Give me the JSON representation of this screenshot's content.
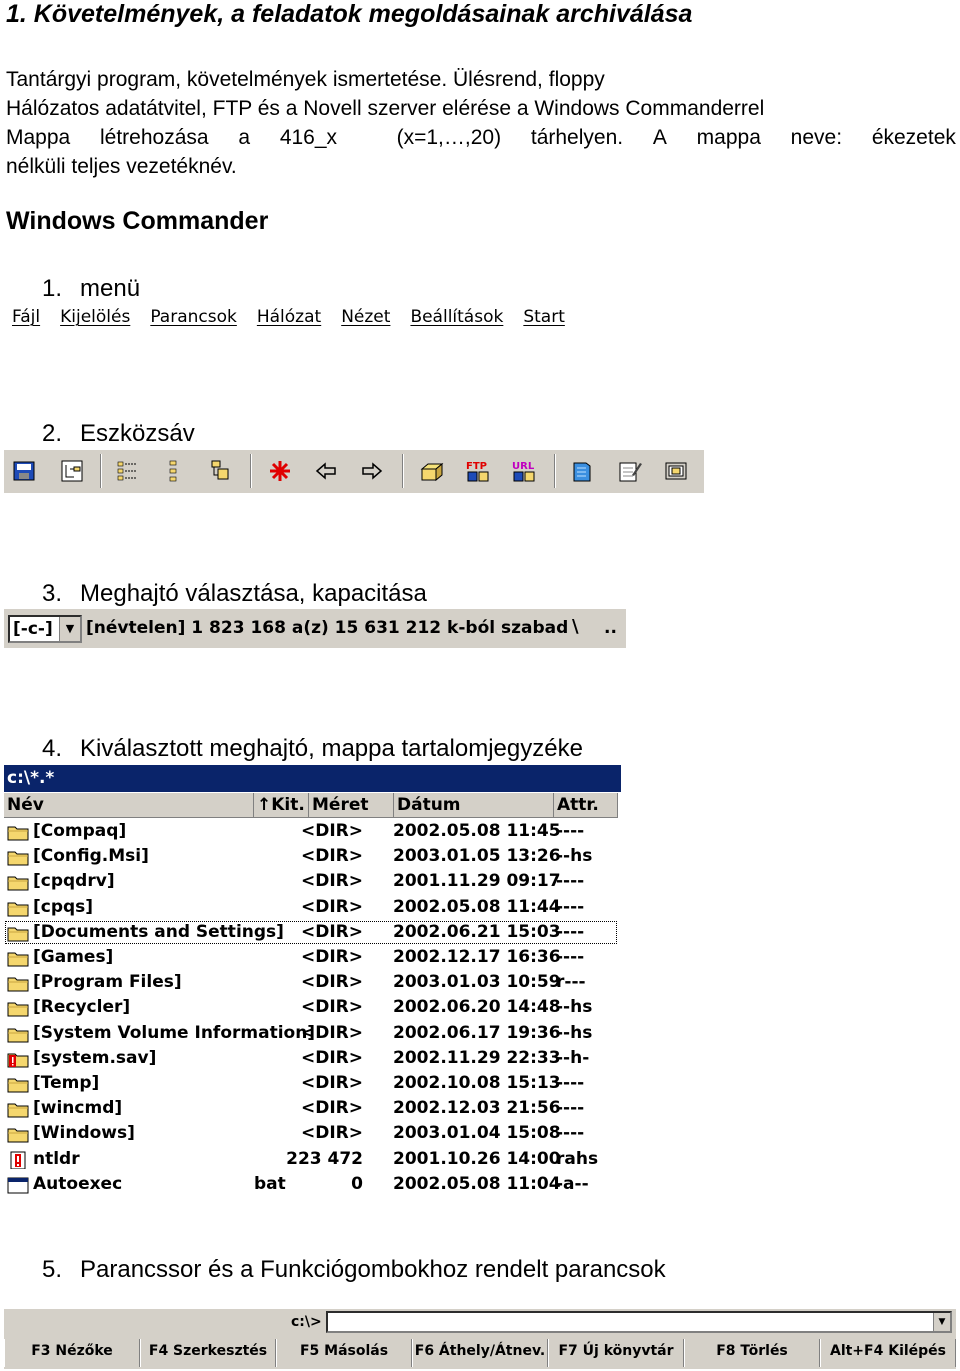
{
  "heading": "1. Követelmények, a feladatok megoldásainak archiválása",
  "intro": {
    "line1": "Tantárgyi program, követelmények ismertetése. Ülésrend, floppy",
    "line2": "Hálózatos adatátvitel, FTP és a Novell szerver elérése a Windows Commanderrel",
    "line3_words": [
      "Mappa",
      "létrehozása",
      "a",
      "416_x",
      "",
      "(x=1,…,20)",
      "tárhelyen.",
      "A",
      "mappa",
      "neve:",
      "ékezetek"
    ],
    "line4": "nélküli teljes vezetéknév."
  },
  "section_title": "Windows Commander",
  "sections": [
    {
      "num": "1.",
      "title": "menü"
    },
    {
      "num": "2.",
      "title": "Eszközsáv"
    },
    {
      "num": "3.",
      "title": "Meghajtó választása, kapacitása"
    },
    {
      "num": "4.",
      "title": "Kiválasztott meghajtó, mappa tartalomjegyzéke"
    },
    {
      "num": "5.",
      "title": "Parancssor és a Funkciógombokhoz rendelt parancsok"
    }
  ],
  "menu": [
    "Fájl",
    "Kijelölés",
    "Parancsok",
    "Hálózat",
    "Nézet",
    "Beállítások",
    "Start"
  ],
  "toolbar_icons": [
    "refresh-icon",
    "tree-icon",
    "brief-view-icon",
    "full-view-icon",
    "thumbnail-icon",
    "select-all-icon",
    "back-icon",
    "forward-icon",
    "pack-icon",
    "ftp-icon",
    "url-icon",
    "notepad-icon",
    "edit-icon",
    "copy-icon"
  ],
  "drive": {
    "selected": "[-c-]",
    "info": "[névtelen]  1 823 168 a(z) 15 631 212 k-ból szabad",
    "root": "\\",
    "up": ".."
  },
  "panel": {
    "path": "c:\\*.*",
    "columns": {
      "name": "Név",
      "ext": "↑Kit.",
      "size": "Méret",
      "date": "Dátum",
      "attr": "Attr."
    },
    "rows": [
      {
        "name": "[Compaq]",
        "ext": "",
        "size": "<DIR>",
        "date": "2002.05.08 11:45",
        "attr": "----",
        "icon": "folder-icon"
      },
      {
        "name": "[Config.Msi]",
        "ext": "",
        "size": "<DIR>",
        "date": "2003.01.05 13:26",
        "attr": "--hs",
        "icon": "folder-icon"
      },
      {
        "name": "[cpqdrv]",
        "ext": "",
        "size": "<DIR>",
        "date": "2001.11.29 09:17",
        "attr": "----",
        "icon": "folder-icon"
      },
      {
        "name": "[cpqs]",
        "ext": "",
        "size": "<DIR>",
        "date": "2002.05.08 11:44",
        "attr": "----",
        "icon": "folder-icon"
      },
      {
        "name": "[Documents and Settings]",
        "ext": "",
        "size": "<DIR>",
        "date": "2002.06.21 15:03",
        "attr": "----",
        "icon": "folder-icon"
      },
      {
        "name": "[Games]",
        "ext": "",
        "size": "<DIR>",
        "date": "2002.12.17 16:36",
        "attr": "----",
        "icon": "folder-icon"
      },
      {
        "name": "[Program Files]",
        "ext": "",
        "size": "<DIR>",
        "date": "2003.01.03 10:59",
        "attr": "r---",
        "icon": "folder-icon"
      },
      {
        "name": "[Recycler]",
        "ext": "",
        "size": "<DIR>",
        "date": "2002.06.20 14:48",
        "attr": "--hs",
        "icon": "folder-icon"
      },
      {
        "name": "[System Volume Information]",
        "ext": "",
        "size": "<DIR>",
        "date": "2002.06.17 19:36",
        "attr": "--hs",
        "icon": "folder-icon"
      },
      {
        "name": "[system.sav]",
        "ext": "",
        "size": "<DIR>",
        "date": "2002.11.29 22:33",
        "attr": "--h-",
        "icon": "hidden-folder-icon"
      },
      {
        "name": "[Temp]",
        "ext": "",
        "size": "<DIR>",
        "date": "2002.10.08 15:13",
        "attr": "----",
        "icon": "folder-icon"
      },
      {
        "name": "[wincmd]",
        "ext": "",
        "size": "<DIR>",
        "date": "2002.12.03 21:56",
        "attr": "----",
        "icon": "folder-icon"
      },
      {
        "name": "[Windows]",
        "ext": "",
        "size": "<DIR>",
        "date": "2003.01.04 15:08",
        "attr": "----",
        "icon": "folder-icon"
      },
      {
        "name": "ntldr",
        "ext": "",
        "size": "223 472",
        "date": "2001.10.26 14:00",
        "attr": "rahs",
        "icon": "system-file-icon"
      },
      {
        "name": "Autoexec",
        "ext": "bat",
        "size": "0",
        "date": "2002.05.08 11:04",
        "attr": "-a--",
        "icon": "batch-file-icon"
      }
    ]
  },
  "command": {
    "prompt": "c:\\>",
    "fkeys": [
      "F3 Nézőke",
      "F4 Szerkesztés",
      "F5 Másolás",
      "F6 Áthely/Átnev.",
      "F7 Új könyvtár",
      "F8 Törlés",
      "Alt+F4 Kilépés"
    ]
  },
  "colors": {
    "title_bar": "#0a246a",
    "face": "#d4d0c8",
    "folder": "#f5d76e"
  }
}
